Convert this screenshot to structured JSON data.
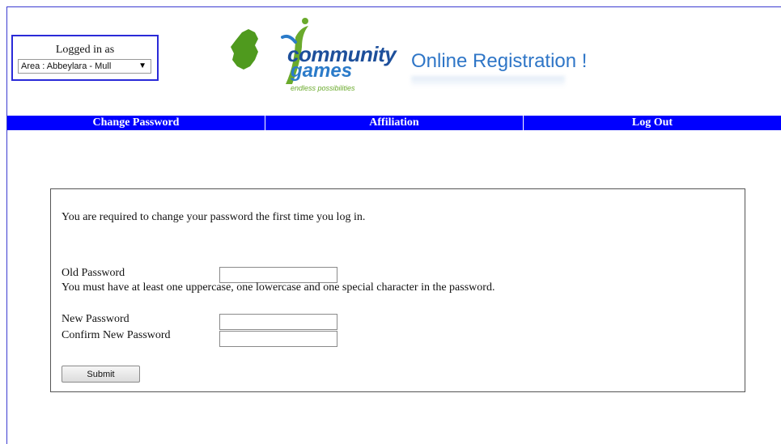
{
  "header": {
    "logged_in_label": "Logged in as",
    "area_selected": "Area : Abbeylara - Mull",
    "logo_community": "community",
    "logo_games": "games",
    "logo_tagline": "endless possibilities",
    "registration_title": "Online Registration !"
  },
  "nav": {
    "items": [
      {
        "label": "Change Password"
      },
      {
        "label": "Affiliation"
      },
      {
        "label": "Log Out"
      }
    ]
  },
  "form": {
    "intro": "You are required to change your password the first time you log in.",
    "old_password_label": "Old Password",
    "password_rule": "You must have at least one uppercase, one lowercase and one special character in the password.",
    "new_password_label": "New Password",
    "confirm_password_label": "Confirm New Password",
    "old_password_value": "",
    "new_password_value": "",
    "confirm_password_value": "",
    "submit_label": "Submit"
  },
  "colors": {
    "nav_bar": "#0000ff",
    "login_box_border": "#2a2ad8",
    "title_blue": "#2f76c7",
    "logo_dark_blue": "#1d4f9b",
    "logo_green": "#4f9a1e"
  }
}
